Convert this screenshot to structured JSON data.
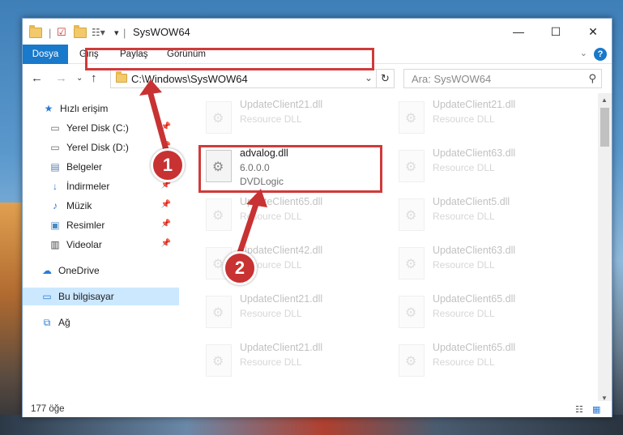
{
  "window": {
    "title": "SysWOW64",
    "controls": {
      "minimize": "—",
      "maximize": "☐",
      "close": "✕"
    }
  },
  "ribbon": {
    "tabs": [
      {
        "label": "Dosya"
      },
      {
        "label": "Giriş"
      },
      {
        "label": "Paylaş"
      },
      {
        "label": "Görünüm"
      }
    ],
    "help": "?"
  },
  "nav": {
    "address": "C:\\Windows\\SysWOW64",
    "search_placeholder": "Ara: SysWOW64"
  },
  "sidebar": {
    "items": [
      {
        "label": "Hızlı erişim",
        "icon": "star-icon",
        "pinned": false
      },
      {
        "label": "Yerel Disk (C:)",
        "icon": "drive-icon",
        "pinned": true
      },
      {
        "label": "Yerel Disk (D:)",
        "icon": "drive-icon",
        "pinned": true
      },
      {
        "label": "Belgeler",
        "icon": "documents-icon",
        "pinned": true
      },
      {
        "label": "İndirmeler",
        "icon": "download-icon",
        "pinned": true
      },
      {
        "label": "Müzik",
        "icon": "music-icon",
        "pinned": true
      },
      {
        "label": "Resimler",
        "icon": "pictures-icon",
        "pinned": true
      },
      {
        "label": "Videolar",
        "icon": "video-icon",
        "pinned": true
      },
      {
        "label": "OneDrive",
        "icon": "cloud-icon",
        "pinned": false
      },
      {
        "label": "Bu bilgisayar",
        "icon": "computer-icon",
        "pinned": false,
        "selected": true
      },
      {
        "label": "Ağ",
        "icon": "network-icon",
        "pinned": false
      }
    ]
  },
  "files": {
    "highlighted": {
      "name": "advalog.dll",
      "version": "6.0.0.0",
      "company": "DVDLogic"
    },
    "left_column": [
      {
        "name": "UpdateClient21.dll",
        "desc": "Resource DLL"
      },
      {
        "name": "UpdateClient65.dll",
        "desc": "Resource DLL"
      },
      {
        "name": "UpdateClient42.dll",
        "desc": "Resource DLL"
      },
      {
        "name": "UpdateClient21.dll",
        "desc": "Resource DLL"
      },
      {
        "name": "UpdateClient21.dll",
        "desc": "Resource DLL"
      }
    ],
    "right_column": [
      {
        "name": "UpdateClient21.dll",
        "desc": "Resource DLL"
      },
      {
        "name": "UpdateClient63.dll",
        "desc": "Resource DLL"
      },
      {
        "name": "UpdateClient5.dll",
        "desc": "Resource DLL"
      },
      {
        "name": "UpdateClient63.dll",
        "desc": "Resource DLL"
      },
      {
        "name": "UpdateClient65.dll",
        "desc": "Resource DLL"
      },
      {
        "name": "UpdateClient65.dll",
        "desc": "Resource DLL"
      }
    ]
  },
  "status": {
    "count": "177 öğe"
  },
  "annotations": {
    "step1": "1",
    "step2": "2",
    "color": "#c83232"
  }
}
